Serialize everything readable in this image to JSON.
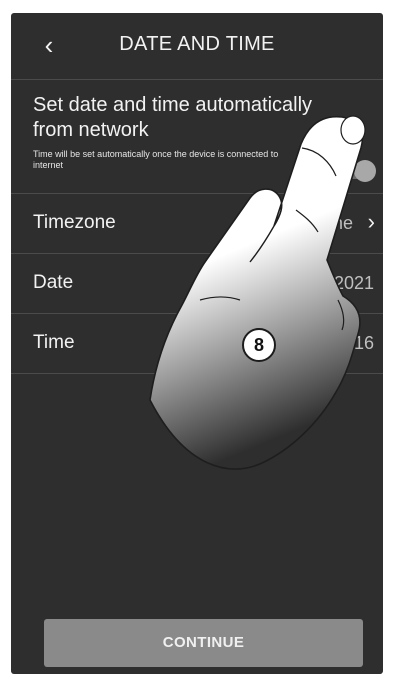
{
  "header": {
    "back_icon": "‹",
    "title": "DATE AND TIME"
  },
  "auto_setting": {
    "title": "Set date and time automatically from network",
    "subtitle": "Time will be set automatically once the device is connected to internet",
    "enabled": true
  },
  "rows": [
    {
      "label": "Timezone",
      "value": "Europe/Rome",
      "arrow": "›"
    },
    {
      "label": "Date",
      "value": "01/01/2021"
    },
    {
      "label": "Time",
      "value": "10:46:16"
    }
  ],
  "continue_label": "CONTINUE",
  "callout_number": "8",
  "colors": {
    "background": "#2e2e2e",
    "button": "#8a8a8a",
    "text": "#f2f2f2"
  }
}
